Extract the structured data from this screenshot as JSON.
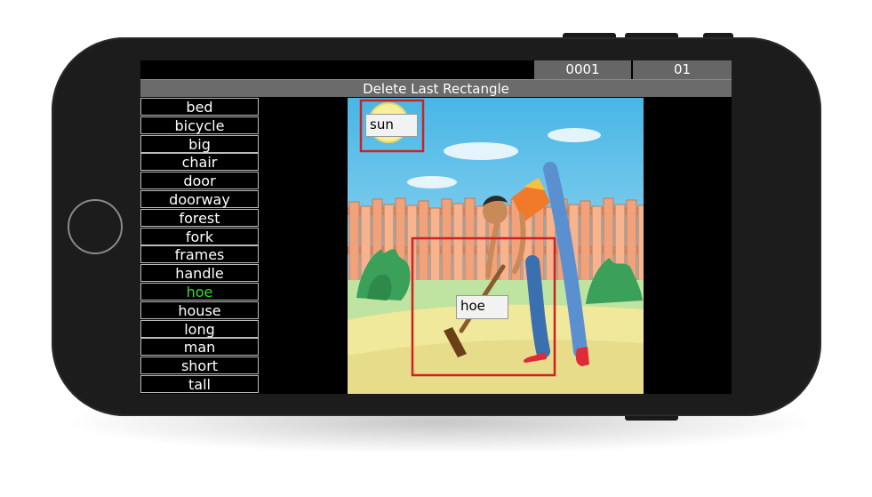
{
  "header": {
    "counter_a": "0001",
    "counter_b": "01",
    "delete_label": "Delete Last Rectangle"
  },
  "words": [
    {
      "label": "bed"
    },
    {
      "label": "bicycle"
    },
    {
      "label": "big"
    },
    {
      "label": "chair"
    },
    {
      "label": "door"
    },
    {
      "label": "doorway"
    },
    {
      "label": "forest"
    },
    {
      "label": "fork"
    },
    {
      "label": "frames"
    },
    {
      "label": "handle"
    },
    {
      "label": "hoe",
      "selected": true
    },
    {
      "label": "house"
    },
    {
      "label": "long"
    },
    {
      "label": "man"
    },
    {
      "label": "short"
    },
    {
      "label": "tall"
    }
  ],
  "annotations": [
    {
      "label": "sun"
    },
    {
      "label": "hoe"
    }
  ],
  "colors": {
    "selected_word": "#33dd33",
    "rectangle": "#cc2222",
    "sky": "#6cc7ee",
    "fence": "#f2a27a"
  }
}
